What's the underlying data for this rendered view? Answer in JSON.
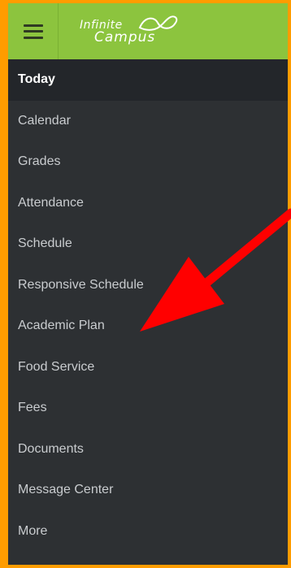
{
  "header": {
    "menu_icon": "hamburger-icon",
    "logo_line1": "Infinite",
    "logo_line2": "Campus",
    "header_color": "#8cc43e",
    "border_color": "#ff9c00"
  },
  "nav": {
    "items": [
      {
        "label": "Today",
        "active": true
      },
      {
        "label": "Calendar",
        "active": false
      },
      {
        "label": "Grades",
        "active": false
      },
      {
        "label": "Attendance",
        "active": false
      },
      {
        "label": "Schedule",
        "active": false
      },
      {
        "label": "Responsive Schedule",
        "active": false
      },
      {
        "label": "Academic Plan",
        "active": false
      },
      {
        "label": "Food Service",
        "active": false
      },
      {
        "label": "Fees",
        "active": false
      },
      {
        "label": "Documents",
        "active": false
      },
      {
        "label": "Message Center",
        "active": false
      },
      {
        "label": "More",
        "active": false
      }
    ]
  },
  "annotation": {
    "arrow_color": "#ff0000",
    "points_to": "Academic Plan"
  }
}
